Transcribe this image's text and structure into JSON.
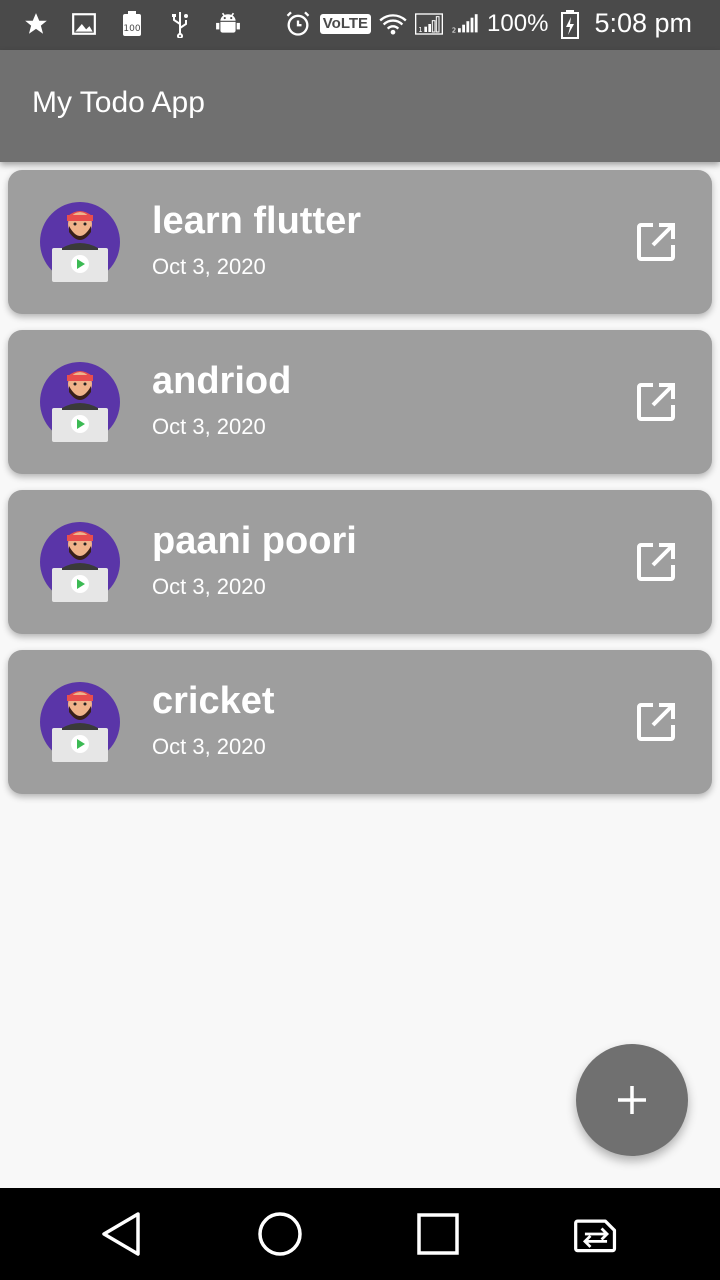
{
  "status_bar": {
    "left_icons": [
      "star-icon",
      "image-icon",
      "storage-100-icon",
      "usb-icon",
      "android-debug-icon"
    ],
    "volte_label": "VoLTE",
    "battery_text": "100%",
    "time": "5:08 pm"
  },
  "app_bar": {
    "title": "My Todo App"
  },
  "todos": [
    {
      "title": "learn flutter",
      "date": "Oct 3, 2020"
    },
    {
      "title": "andriod",
      "date": "Oct 3, 2020"
    },
    {
      "title": "paani poori",
      "date": "Oct 3, 2020"
    },
    {
      "title": "cricket",
      "date": "Oct 3, 2020"
    }
  ],
  "fab": {
    "icon": "plus-icon"
  },
  "nav_bar": {
    "icons": [
      "back-icon",
      "home-icon",
      "recents-icon",
      "switch-sim-icon"
    ]
  },
  "colors": {
    "status_bar": "#4a4a4a",
    "app_bar": "#707070",
    "card": "#9e9e9e",
    "fab": "#707070",
    "background": "#f8f8f8",
    "avatar_purple": "#5a35a8"
  }
}
